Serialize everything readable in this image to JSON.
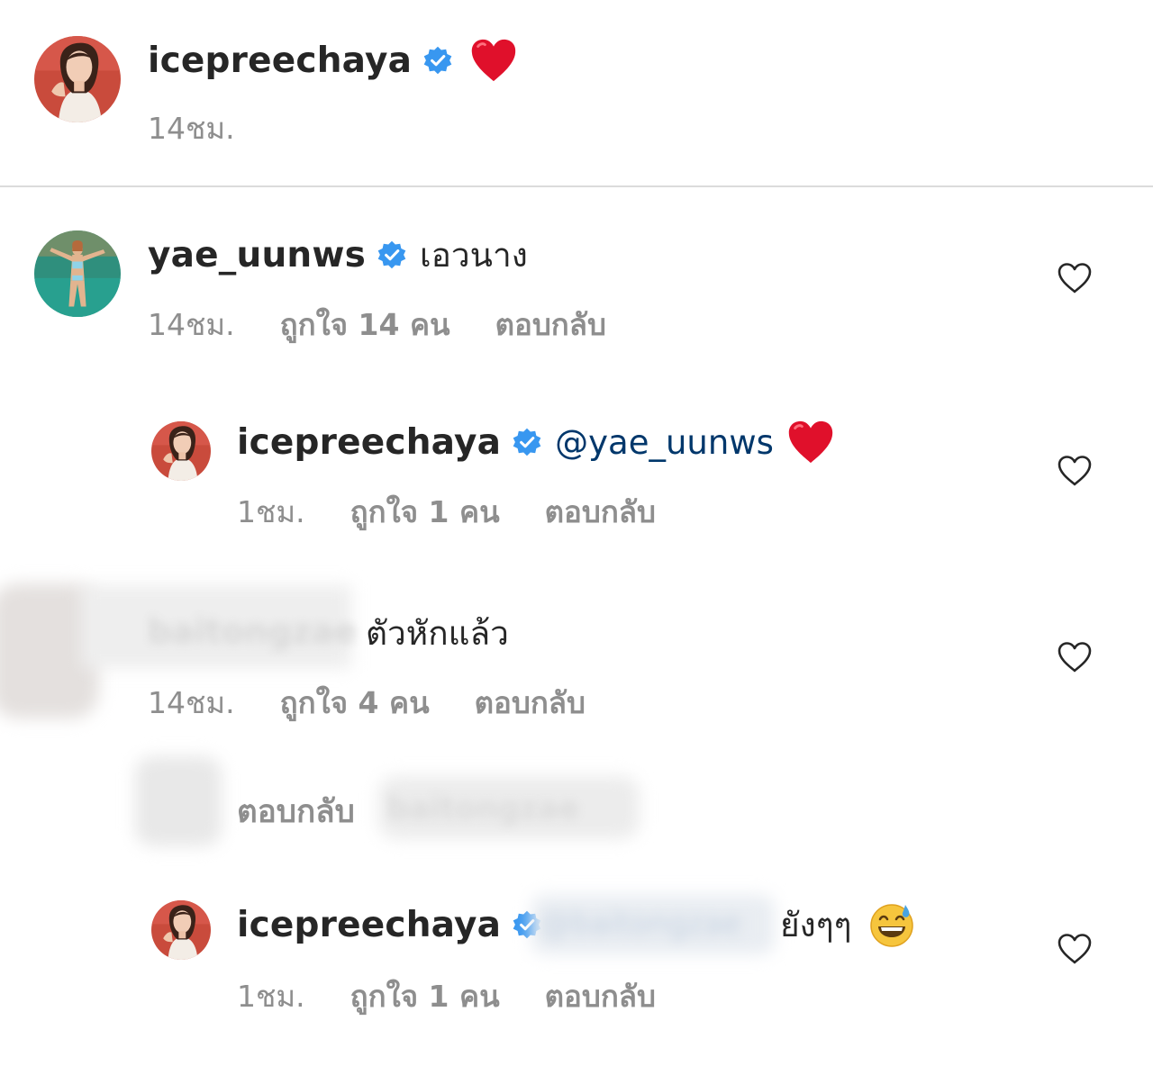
{
  "caption": {
    "username": "icepreechaya",
    "time": "14ชม."
  },
  "comments": [
    {
      "username": "yae_uunws",
      "text": "เอวนาง",
      "time": "14ชม.",
      "likes": "ถูกใจ 14 คน",
      "reply": "ตอบกลับ"
    },
    {
      "username": "icepreechaya",
      "mention": "@yae_uunws",
      "time": "1ชม.",
      "likes": "ถูกใจ 1 คน",
      "reply": "ตอบกลับ"
    },
    {
      "username_blurred": "baitongzae",
      "text": "ตัวหักแล้ว",
      "time": "14ชม.",
      "likes": "ถูกใจ 4 คน",
      "reply": "ตอบกลับ"
    },
    {
      "view_replies_label": "ตอบกลับ",
      "view_replies_blurred": "baitongzae"
    },
    {
      "username": "icepreechaya",
      "mention_blurred": "@baitongzae",
      "text": "ยังๆๆ",
      "time": "1ชม.",
      "likes": "ถูกใจ 1 คน",
      "reply": "ตอบกลับ"
    }
  ],
  "icons": {
    "verified": "verified-badge-icon",
    "heart_emoji": "red-heart-emoji",
    "like": "heart-outline-icon",
    "sweat_smile": "grinning-sweat-emoji"
  },
  "colors": {
    "verified_blue": "#3897f0",
    "heart_red": "#e0102b",
    "text": "#262626",
    "meta": "#8e8e8e",
    "mention": "#00376b"
  }
}
